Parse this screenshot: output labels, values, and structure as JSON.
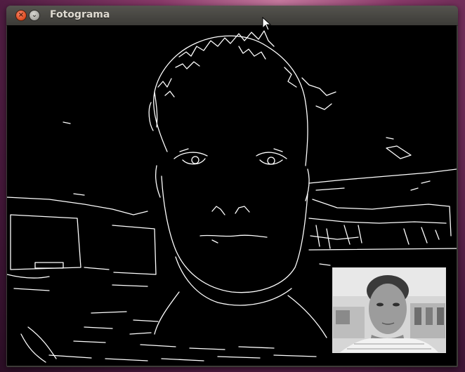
{
  "window": {
    "title": "Fotograma",
    "close_glyph": "×",
    "minimize_glyph": "⌄"
  },
  "icons": {
    "close": "close-icon",
    "minimize": "minimize-icon",
    "cursor": "mouse-pointer-icon"
  },
  "colors": {
    "canvas_background": "#000000",
    "edge_lines": "#ffffff",
    "close_button": "#de4a1e",
    "titlebar": "#3c3b37"
  }
}
